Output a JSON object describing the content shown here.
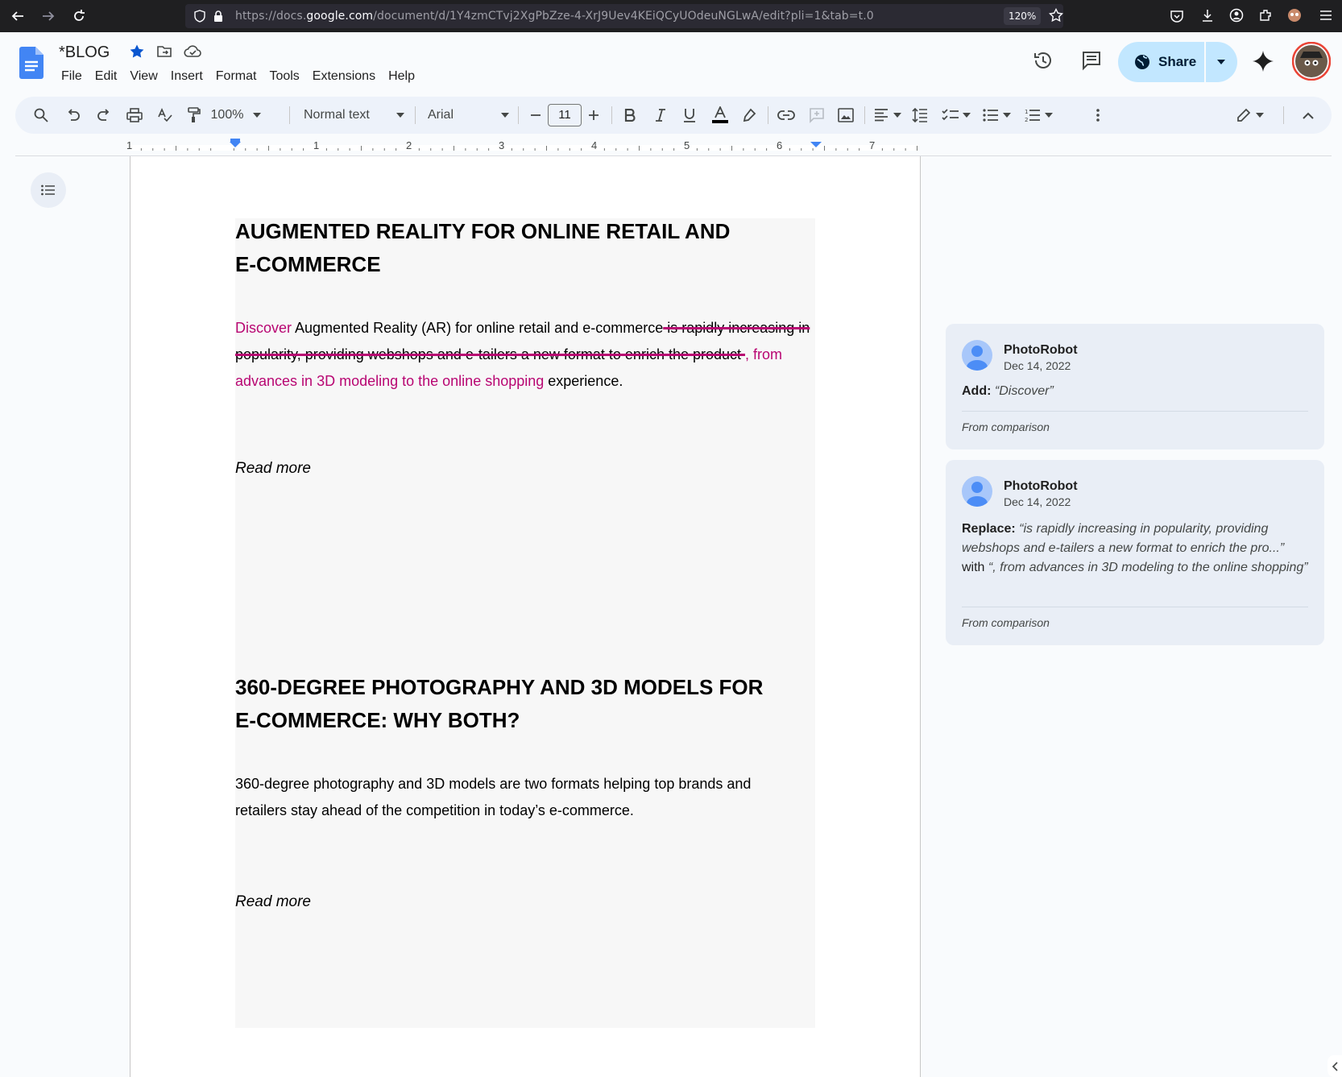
{
  "browser": {
    "url_prefix": "https://docs.",
    "url_domain": "google.com",
    "url_rest": "/document/d/1Y4zmCTvj2XgPbZze-4-XrJ9Uev4KEiQCyUOdeuNGLwA/edit?pli=1&tab=t.0",
    "zoom": "120%"
  },
  "doc": {
    "title": "*BLOG",
    "menu": [
      "File",
      "Edit",
      "View",
      "Insert",
      "Format",
      "Tools",
      "Extensions",
      "Help"
    ],
    "share_label": "Share"
  },
  "toolbar": {
    "zoom": "100%",
    "style": "Normal text",
    "font": "Arial",
    "font_size": "11"
  },
  "ruler": {
    "numbers": [
      "1",
      "1",
      "2",
      "3",
      "4",
      "5",
      "6",
      "7"
    ]
  },
  "content": {
    "section1": {
      "heading_line1": "AUGMENTED REALITY FOR ONLINE RETAIL AND",
      "heading_line2": "E-COMMERCE",
      "ins_discover": "Discover",
      "text_normal": " Augmented Reality (AR) for online retail  and e-commerce",
      "deleted_text": " is rapidly increasing in popularity, providing webshops and e-tailers a new format to enrich the product ",
      "inserted_text": ", from advances in 3D modeling to the online shopping",
      "text_end": "  experience.",
      "read_more": "Read more"
    },
    "section2": {
      "heading_line1": "360-DEGREE PHOTOGRAPHY AND 3D MODELS FOR",
      "heading_line2": "E-COMMERCE: WHY BOTH?",
      "para_line1": "360-degree photography and 3D models are two formats helping top brands and",
      "para_line2": "retailers stay ahead of the competition in today’s e-commerce.",
      "read_more": "Read more"
    }
  },
  "comments": [
    {
      "author": "PhotoRobot",
      "date": "Dec 14, 2022",
      "action": "Add:",
      "quote": "“Discover”",
      "footer": "From comparison"
    },
    {
      "author": "PhotoRobot",
      "date": "Dec 14, 2022",
      "action": "Replace:",
      "quote_old": "“is rapidly increasing in popularity, providing webshops and e-tailers a new format to enrich the pro...”",
      "with_label": "with",
      "quote_new": "“, from advances in 3D modeling to the online shopping”",
      "footer": "From comparison"
    }
  ],
  "colors": {
    "suggestion": "#b80672",
    "share_bg": "#c2e7ff",
    "toolbar_bg": "#edf2fa",
    "comment_bg": "#e9eef6"
  }
}
